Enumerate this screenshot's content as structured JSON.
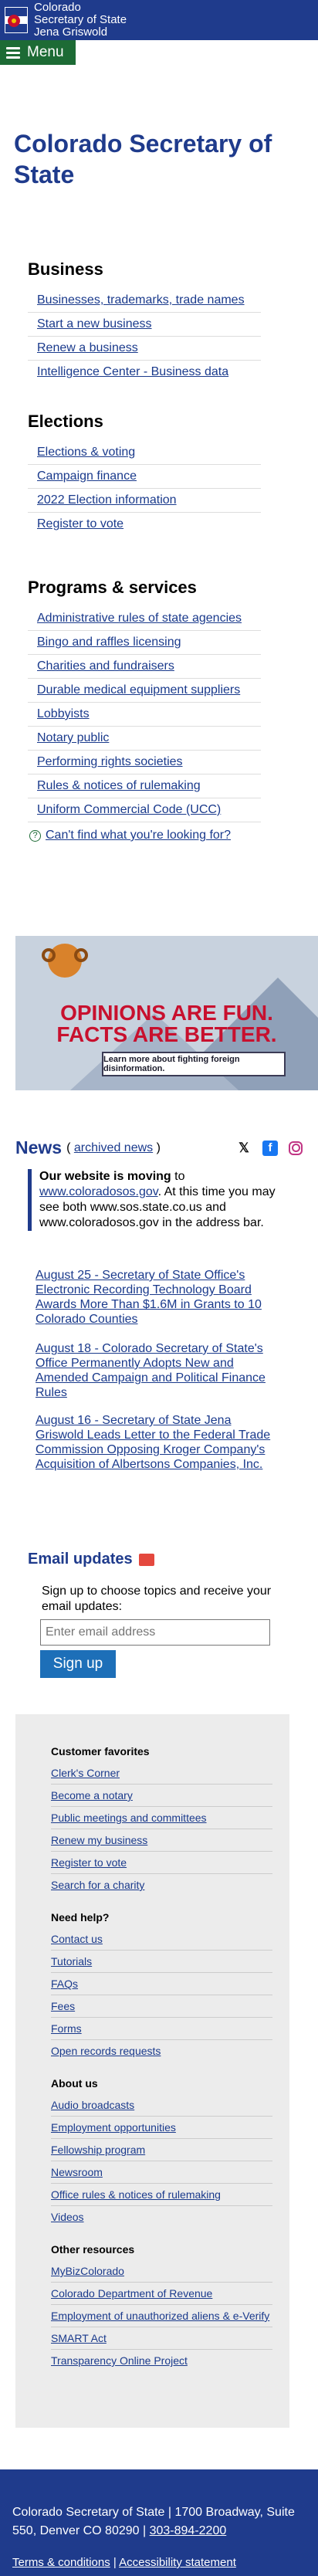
{
  "header": {
    "brand_line1": "Colorado",
    "brand_line2": "Secretary of State",
    "brand_line3": "Jena Griswold",
    "menu_label": "Menu"
  },
  "page_title": "Colorado Secretary of State",
  "business": {
    "heading": "Business",
    "links": [
      "Businesses, trademarks, trade names",
      "Start a new business",
      "Renew a business",
      "Intelligence Center - Business data"
    ]
  },
  "elections": {
    "heading": "Elections",
    "links": [
      "Elections & voting",
      "Campaign finance",
      "2022 Election information",
      "Register to vote"
    ]
  },
  "programs": {
    "heading": "Programs & services",
    "links": [
      "Administrative rules of state agencies",
      "Bingo and raffles licensing",
      "Charities and fundraisers",
      "Durable medical equipment suppliers",
      "Lobbyists",
      "Notary public",
      "Performing rights societies",
      "Rules & notices of rulemaking",
      "Uniform Commercial Code (UCC)"
    ]
  },
  "cant_find": "Can't find what you're looking for?",
  "banner": {
    "line1": "OPINIONS ARE FUN.",
    "line2": "FACTS ARE BETTER.",
    "cta": "Learn more about fighting foreign disinformation."
  },
  "news": {
    "heading": "News",
    "paren_open": "(",
    "archived": "archived news",
    "paren_close": ")",
    "notice_bold": "Our website is moving",
    "notice_to": " to ",
    "notice_link": "www.coloradosos.gov",
    "notice_rest": ". At this time you may see both www.sos.state.co.us and www.coloradosos.gov in the address bar.",
    "items": [
      "August 25 - Secretary of State Office's Electronic Recording Technology Board Awards More Than $1.6M in Grants to 10 Colorado Counties",
      "August 18 - Colorado Secretary of State's Office Permanently Adopts New and Amended Campaign and Political Finance Rules",
      "August 16 - Secretary of State Jena Griswold Leads Letter to the Federal Trade Commission Opposing Kroger Company's Acquisition of Albertsons Companies, Inc."
    ]
  },
  "email": {
    "heading": "Email updates",
    "desc": "Sign up to choose topics and receive your email updates:",
    "placeholder": "Enter email address",
    "button": "Sign up"
  },
  "favorites": {
    "groups": [
      {
        "heading": "Customer favorites",
        "links": [
          "Clerk's Corner",
          "Become a notary",
          "Public meetings and committees",
          "Renew my business",
          "Register to vote",
          "Search for a charity"
        ]
      },
      {
        "heading": "Need help?",
        "links": [
          "Contact us",
          "Tutorials",
          "FAQs",
          "Fees",
          "Forms",
          "Open records requests"
        ]
      },
      {
        "heading": "About us",
        "links": [
          "Audio broadcasts",
          "Employment opportunities",
          "Fellowship program",
          "Newsroom",
          "Office rules & notices of rulemaking",
          "Videos"
        ]
      },
      {
        "heading": "Other resources",
        "links": [
          "MyBizColorado",
          "Colorado Department of Revenue",
          "Employment of unauthorized aliens & e-Verify",
          "SMART Act",
          "Transparency Online Project"
        ]
      }
    ]
  },
  "footer": {
    "address": "Colorado Secretary of State | 1700 Broadway, Suite 550, Denver CO 80290 |",
    "phone": "303-894-2200",
    "terms": "Terms & conditions",
    "sep": "|",
    "access": "Accessibility statement"
  },
  "colors": {
    "primary": "#1f3b8c",
    "menu_green": "#1d6b35",
    "signup_blue": "#1d6fb8",
    "banner_red": "#c8102e"
  }
}
